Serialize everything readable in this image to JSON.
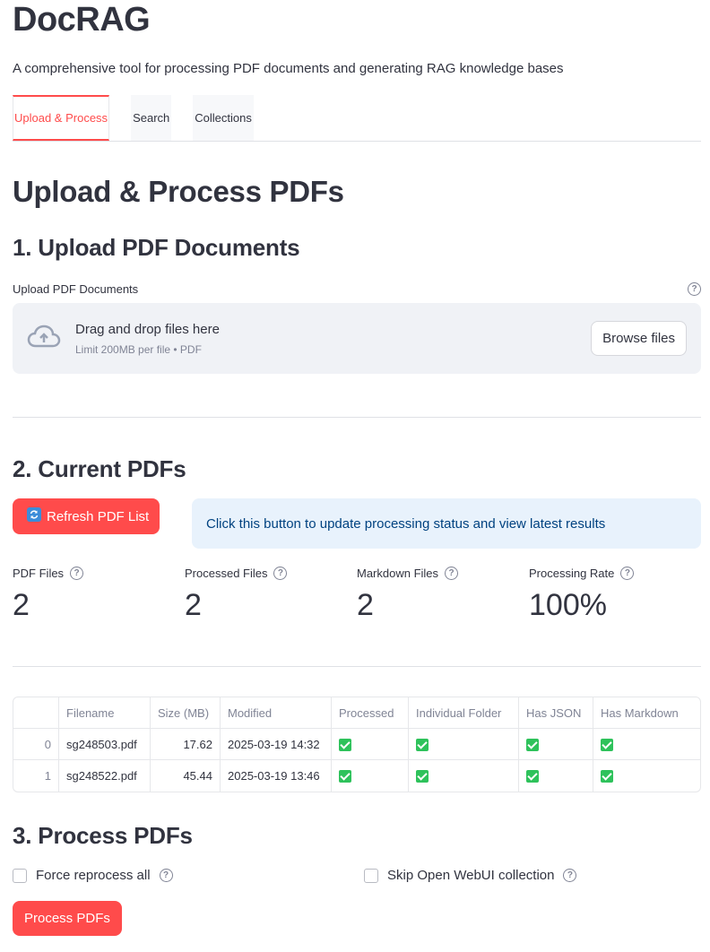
{
  "app": {
    "title": "DocRAG",
    "subtitle": "A comprehensive tool for processing PDF documents and generating RAG knowledge bases"
  },
  "tabs": [
    {
      "label": "Upload & Process",
      "active": true
    },
    {
      "label": "Search",
      "active": false
    },
    {
      "label": "Collections",
      "active": false
    }
  ],
  "main": {
    "title": "Upload & Process PDFs",
    "upload_section": {
      "heading": "1. Upload PDF Documents",
      "field_label": "Upload PDF Documents",
      "dropzone_title": "Drag and drop files here",
      "dropzone_limit": "Limit 200MB per file • PDF",
      "browse_label": "Browse files"
    },
    "current_section": {
      "heading": "2. Current PDFs",
      "refresh_label": "Refresh PDF List",
      "info_text": "Click this button to update processing status and view latest results",
      "metrics": [
        {
          "label": "PDF Files",
          "value": "2"
        },
        {
          "label": "Processed Files",
          "value": "2"
        },
        {
          "label": "Markdown Files",
          "value": "2"
        },
        {
          "label": "Processing Rate",
          "value": "100%"
        }
      ],
      "table": {
        "columns": [
          "",
          "Filename",
          "Size (MB)",
          "Modified",
          "Processed",
          "Individual Folder",
          "Has JSON",
          "Has Markdown"
        ],
        "rows": [
          {
            "index": "0",
            "filename": "sg248503.pdf",
            "size": "17.62",
            "modified": "2025-03-19 14:32",
            "processed": true,
            "individual_folder": true,
            "has_json": true,
            "has_markdown": true
          },
          {
            "index": "1",
            "filename": "sg248522.pdf",
            "size": "45.44",
            "modified": "2025-03-19 13:46",
            "processed": true,
            "individual_folder": true,
            "has_json": true,
            "has_markdown": true
          }
        ]
      }
    },
    "process_section": {
      "heading": "3. Process PDFs",
      "force_label": "Force reprocess all",
      "skip_label": "Skip Open WebUI collection",
      "process_label": "Process PDFs"
    }
  },
  "colors": {
    "accent": "#ff4b4b",
    "info_bg": "#e8f2fc",
    "info_text": "#004280",
    "check_green": "#2ec25b"
  }
}
